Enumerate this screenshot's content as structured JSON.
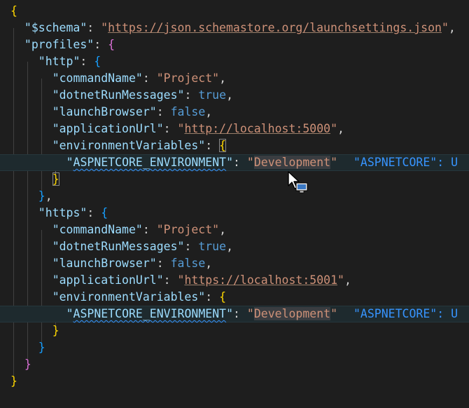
{
  "editor": {
    "language": "json",
    "lines": [
      {
        "id": "open-root",
        "tokens": [
          {
            "t": "{",
            "c": "br1"
          }
        ]
      },
      {
        "id": "schema",
        "tokens": [
          {
            "t": "\"$schema\"",
            "c": "k"
          },
          {
            "t": ": ",
            "c": "p"
          },
          {
            "t": "\"",
            "c": "s"
          },
          {
            "t": "https://json.schemastore.org/launchsettings.json",
            "c": "s url"
          },
          {
            "t": "\"",
            "c": "s"
          },
          {
            "t": ",",
            "c": "p"
          }
        ]
      },
      {
        "id": "profiles",
        "tokens": [
          {
            "t": "\"profiles\"",
            "c": "k"
          },
          {
            "t": ": ",
            "c": "p"
          },
          {
            "t": "{",
            "c": "br2"
          }
        ]
      },
      {
        "id": "http",
        "tokens": [
          {
            "t": "\"http\"",
            "c": "k"
          },
          {
            "t": ": ",
            "c": "p"
          },
          {
            "t": "{",
            "c": "br3"
          }
        ]
      },
      {
        "id": "http-commandName",
        "tokens": [
          {
            "t": "\"commandName\"",
            "c": "k"
          },
          {
            "t": ": ",
            "c": "p"
          },
          {
            "t": "\"Project\"",
            "c": "s"
          },
          {
            "t": ",",
            "c": "p"
          }
        ]
      },
      {
        "id": "http-dotnetRunMessages",
        "tokens": [
          {
            "t": "\"dotnetRunMessages\"",
            "c": "k"
          },
          {
            "t": ": ",
            "c": "p"
          },
          {
            "t": "true",
            "c": "b"
          },
          {
            "t": ",",
            "c": "p"
          }
        ]
      },
      {
        "id": "http-launchBrowser",
        "tokens": [
          {
            "t": "\"launchBrowser\"",
            "c": "k"
          },
          {
            "t": ": ",
            "c": "p"
          },
          {
            "t": "false",
            "c": "b"
          },
          {
            "t": ",",
            "c": "p"
          }
        ]
      },
      {
        "id": "http-applicationUrl",
        "tokens": [
          {
            "t": "\"applicationUrl\"",
            "c": "k"
          },
          {
            "t": ": ",
            "c": "p"
          },
          {
            "t": "\"",
            "c": "s"
          },
          {
            "t": "http://localhost:5000",
            "c": "s url"
          },
          {
            "t": "\"",
            "c": "s"
          },
          {
            "t": ",",
            "c": "p"
          }
        ]
      },
      {
        "id": "http-environmentVariables",
        "tokens": [
          {
            "t": "\"environmentVariables\"",
            "c": "k"
          },
          {
            "t": ": ",
            "c": "p"
          },
          {
            "t": "{",
            "c": "br1 bmatch"
          }
        ]
      },
      {
        "id": "http-aspnetcore-env",
        "highlight": true,
        "tokens": [
          {
            "t": "\"",
            "c": "k"
          },
          {
            "t": "ASPNETCORE_ENVIRONMENT",
            "c": "k squig"
          },
          {
            "t": "\"",
            "c": "k"
          },
          {
            "t": ": ",
            "c": "p"
          },
          {
            "t": "\"",
            "c": "s"
          },
          {
            "t": "Development",
            "c": "s sel"
          },
          {
            "t": "\"",
            "c": "s"
          }
        ],
        "ghost": "\"ASPNETCORE\": U"
      },
      {
        "id": "http-env-close",
        "tokens": [
          {
            "t": "}",
            "c": "br1 bmatch"
          }
        ]
      },
      {
        "id": "http-close",
        "tokens": [
          {
            "t": "}",
            "c": "br3"
          },
          {
            "t": ",",
            "c": "p"
          }
        ]
      },
      {
        "id": "https",
        "tokens": [
          {
            "t": "\"https\"",
            "c": "k"
          },
          {
            "t": ": ",
            "c": "p"
          },
          {
            "t": "{",
            "c": "br3"
          }
        ]
      },
      {
        "id": "https-commandName",
        "tokens": [
          {
            "t": "\"commandName\"",
            "c": "k"
          },
          {
            "t": ": ",
            "c": "p"
          },
          {
            "t": "\"Project\"",
            "c": "s"
          },
          {
            "t": ",",
            "c": "p"
          }
        ]
      },
      {
        "id": "https-dotnetRunMessages",
        "tokens": [
          {
            "t": "\"dotnetRunMessages\"",
            "c": "k"
          },
          {
            "t": ": ",
            "c": "p"
          },
          {
            "t": "true",
            "c": "b"
          },
          {
            "t": ",",
            "c": "p"
          }
        ]
      },
      {
        "id": "https-launchBrowser",
        "tokens": [
          {
            "t": "\"launchBrowser\"",
            "c": "k"
          },
          {
            "t": ": ",
            "c": "p"
          },
          {
            "t": "false",
            "c": "b"
          },
          {
            "t": ",",
            "c": "p"
          }
        ]
      },
      {
        "id": "https-applicationUrl",
        "tokens": [
          {
            "t": "\"applicationUrl\"",
            "c": "k"
          },
          {
            "t": ": ",
            "c": "p"
          },
          {
            "t": "\"",
            "c": "s"
          },
          {
            "t": "https://localhost:5001",
            "c": "s url"
          },
          {
            "t": "\"",
            "c": "s"
          },
          {
            "t": ",",
            "c": "p"
          }
        ]
      },
      {
        "id": "https-environmentVariables",
        "tokens": [
          {
            "t": "\"environmentVariables\"",
            "c": "k"
          },
          {
            "t": ": ",
            "c": "p"
          },
          {
            "t": "{",
            "c": "br1"
          }
        ]
      },
      {
        "id": "https-aspnetcore-env",
        "highlight": true,
        "tokens": [
          {
            "t": "\"",
            "c": "k"
          },
          {
            "t": "ASPNETCORE_ENVIRONMENT",
            "c": "k squig"
          },
          {
            "t": "\"",
            "c": "k"
          },
          {
            "t": ": ",
            "c": "p"
          },
          {
            "t": "\"",
            "c": "s"
          },
          {
            "t": "Development",
            "c": "s sel"
          },
          {
            "t": "\"",
            "c": "s"
          }
        ],
        "ghost": "\"ASPNETCORE\": U"
      },
      {
        "id": "https-env-close",
        "tokens": [
          {
            "t": "}",
            "c": "br1"
          }
        ]
      },
      {
        "id": "https-close",
        "tokens": [
          {
            "t": "}",
            "c": "br3"
          }
        ]
      },
      {
        "id": "profiles-close",
        "tokens": [
          {
            "t": "}",
            "c": "br2"
          }
        ]
      },
      {
        "id": "close-root",
        "tokens": [
          {
            "t": "}",
            "c": "br1"
          }
        ]
      }
    ]
  },
  "colors": {
    "background": "#1e1e1e",
    "key": "#9cdcfe",
    "string": "#ce9178",
    "boolean": "#569cd6",
    "bracket_gold": "#ffd700",
    "bracket_purple": "#da70d6",
    "bracket_blue": "#179fff",
    "ghost_text": "#3794ff"
  },
  "cursor": {
    "icon": "mouse-pointer-drag-icon"
  }
}
